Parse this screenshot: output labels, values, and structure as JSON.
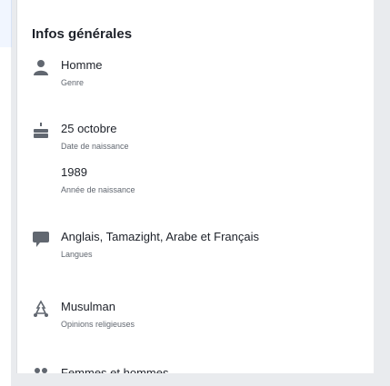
{
  "section": {
    "title": "Infos générales"
  },
  "rows": [
    {
      "value": "Homme",
      "label": "Genre",
      "icon": "person-icon"
    },
    {
      "value": "25 octobre",
      "label": "Date de naissance",
      "icon": "birthday-cake-icon"
    },
    {
      "value": "1989",
      "label": "Année de naissance",
      "icon": ""
    },
    {
      "value": "Anglais, Tamazight, Arabe et Français",
      "label": "Langues",
      "icon": "speech-bubble-icon"
    },
    {
      "value": "Musulman",
      "label": "Opinions religieuses",
      "icon": "religion-icon"
    },
    {
      "value": "Femmes et hommes",
      "label": "",
      "icon": "interested-in-icon"
    }
  ]
}
